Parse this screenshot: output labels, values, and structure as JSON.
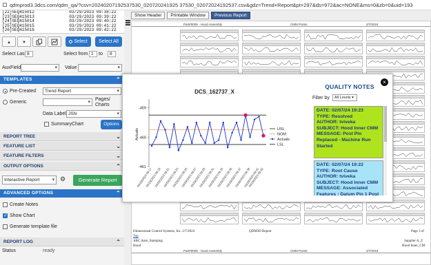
{
  "browser": {
    "url": "qdmprod3.3dcs.com/qdm_qa/?csv=20240207192537530_020720241925 37530_02072024192537.csv&gdz=Trend+Report&pt=297&ds=972&ac=NONE&ms=0&zb=0&uid=193"
  },
  "records": [
    "[22]SEQ415012              03/29/2023 09:38:22",
    "[23]SEQ415013              03/29/2023 09:39:22",
    "[24]SEQ415014              03/29/2023 09:40:22",
    "[25]SEQ415015              03/29/2023 09:41:22",
    "[26]SEQ415016              03/29/2023 09:42:22"
  ],
  "toolbar": {
    "up_icon": "▲",
    "down_icon": "▼",
    "select_label": "Select",
    "select_all_label": "Select All"
  },
  "selection": {
    "last_label": "Select Last",
    "last_value": "8",
    "from_label": "Select from",
    "from_value": "1",
    "to_label": "to",
    "to_value": "8"
  },
  "filters": {
    "auxfield_label": "AuxField:",
    "value_label": "Value"
  },
  "templates": {
    "header": "TEMPLATES",
    "precreated_label": "Pre-Created",
    "precreated_value": "Trend Report",
    "generic_label": "Generic",
    "pages_label": "Pages/ Charts",
    "data_label_label": "Data Label",
    "data_label_value": "JSN",
    "summary_label": "SummaryChart",
    "options_label": "Options"
  },
  "sections": {
    "report_tree": "REPORT TREE",
    "feature_list": "FEATURE LIST",
    "feature_filters": "FEATURE FILTERS",
    "output_options": "OUTPUT OPTIONS",
    "advanced_options": "ADVANCED OPTIONS",
    "report_log": "REPORT LOG"
  },
  "output": {
    "mode": "Interactive Report",
    "generate_label": "Generate Report"
  },
  "advanced": {
    "create_notes": "Create Notes",
    "show_chart": "Show Chart",
    "generate_template": "Generate template file"
  },
  "log": {
    "status_label": "Status",
    "status_value": "ready"
  },
  "report_buttons": {
    "show_header": "Show Header",
    "printable": "Printable Window",
    "previous": "Previous Report"
  },
  "report_bg": {
    "header_part": "Part#0009 - Hood Assembly",
    "header_mode": "CMM Points",
    "header_date": "2/7/2024",
    "footer_company": "Dimensional Control Systems, Inc. 2/7/2024",
    "footer_report": "QDM3D Report",
    "footer_page": "Page 3 of",
    "footer_top": "Top",
    "footer_abc": "ABC Auto_Stamping",
    "footer_hood": "Hood",
    "footer_supplier": "Supplier A_Z",
    "footer_hood_inner": "Hood Inner_CM"
  },
  "chart_data": {
    "type": "line",
    "title": "DCS_162737_X",
    "ylabel": "Actuals",
    "ylim": [
      -461,
      -458.8
    ],
    "yticks": [
      -461,
      -460,
      -459
    ],
    "x": [
      "03/29/2023 09:17",
      "03/29/2023 09:18",
      "03/29/2023 09:19",
      "03/29/2023 09:20",
      "03/29/2023 09:21",
      "03/29/2023 09:22",
      "03/29/2023 09:23",
      "03/29/2023 09:24",
      "03/29/2023 09:25",
      "03/29/2023 09:26",
      "03/29/2023 09:27",
      "03/29/2023 09:28",
      "03/29/2023 09:29",
      "03/29/2023 09:30",
      "03/29/2023 09:31",
      "03/29/2023 09:32",
      "03/29/2023 09:33",
      "03/29/2023 09:34",
      "03/29/2023 09:35",
      "03/29/2023 09:36",
      "03/29/2023 09:37",
      "03/29/2023 09:38",
      "03/29/2023 09:39",
      "03/29/2023 09:40",
      "03/29/2023 09:41",
      "03/29/2023 09:42"
    ],
    "xtick_labels": [
      "03/29/2023 09:17",
      "03/29/2023 09:19",
      "03/29/2023 09:21",
      "03/29/2023 09:23",
      "03/29/2023 09:25",
      "03/29/2023 09:27",
      "03/29/2023 09:29",
      "03/29/2023 09:31",
      "03/29/2023 09:33",
      "03/29/2023 09:35",
      "03/29/2023 09:37",
      "03/29/2023 09:39",
      "03/29/2023 09:41",
      "03/29/2023 09:42"
    ],
    "series": [
      {
        "name": "Actuals",
        "color": "#1a2fd1",
        "values": [
          -460.3,
          -460.0,
          -459.45,
          -459.75,
          -460.35,
          -459.55,
          -460.45,
          -460.1,
          -459.65,
          -460.2,
          -459.5,
          -459.95,
          -460.2,
          -459.5,
          -460.2,
          -460.1,
          -459.5,
          -460.35,
          -459.85,
          -459.5,
          -460.1,
          -459.25,
          -460.0,
          -459.4,
          -459.3,
          -459.95
        ]
      }
    ],
    "reference_lines": [
      {
        "name": "USL",
        "value": -459.25,
        "color": "#222222"
      },
      {
        "name": "NOM",
        "value": -459.75,
        "color": "#e8a25c"
      },
      {
        "name": "LSL",
        "value": -460.25,
        "color": "#222222"
      }
    ],
    "highlighted_points": [
      21,
      25
    ],
    "highlight_color": "#d6156b",
    "legend": [
      "USL",
      "NOM",
      "Actuals",
      "LSL"
    ],
    "legend_position": "right"
  },
  "quality_notes": {
    "title": "QUALITY NOTES",
    "filter_label": "Filter by",
    "filter_value": "All Levels",
    "notes": [
      {
        "bg": "#aee31e",
        "date": "DATE: 02/07/24 19:23",
        "type": "TYPE: Resolved",
        "author": "AUTHOR: tviveka",
        "subject": "SUBJECT: Hood Inner CMM",
        "message": "MESSAGE: Post Pin Replaced - Machine Run Started"
      },
      {
        "bg": "#a8e4f8",
        "date": "DATE: 02/07/24 19:22",
        "type": "TYPE: Root Cause",
        "author": "AUTHOR: tviveka",
        "subject": "SUBJECT: Hood Inner CMM",
        "message": "MESSAGE: Associated Features : Datum Pin 1 Post"
      }
    ]
  }
}
